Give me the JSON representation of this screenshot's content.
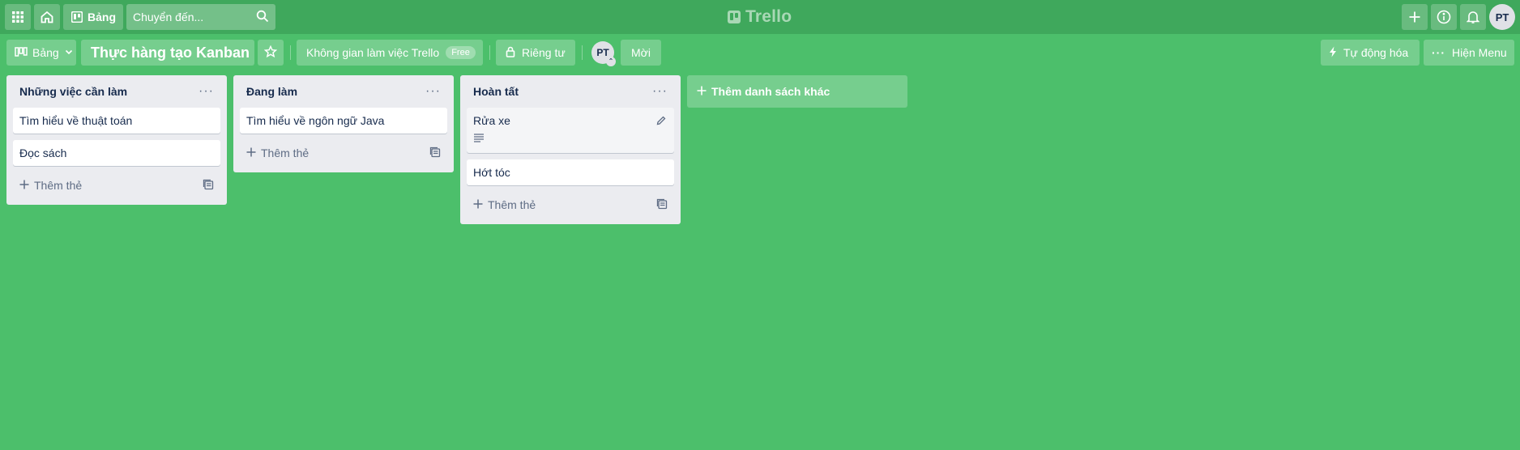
{
  "topbar": {
    "boards_label": "Bảng",
    "search_placeholder": "Chuyển đến...",
    "logo_text": "Trello",
    "user_initials": "PT"
  },
  "board": {
    "view_label": "Bảng",
    "title": "Thực hàng tạo Kanban",
    "workspace_label": "Không gian làm việc Trello",
    "workspace_badge": "Free",
    "visibility_label": "Riêng tư",
    "member_initials": "PT",
    "invite_label": "Mời",
    "automation_label": "Tự động hóa",
    "menu_label": "Hiện Menu"
  },
  "lists": [
    {
      "title": "Những việc cần làm",
      "cards": [
        "Tìm hiểu về thuật toán",
        "Đọc sách"
      ],
      "add_label": "Thêm thẻ"
    },
    {
      "title": "Đang làm",
      "cards": [
        "Tìm hiểu về ngôn ngữ Java"
      ],
      "add_label": "Thêm thẻ"
    },
    {
      "title": "Hoàn tất",
      "cards": [
        "Rửa xe",
        "Hớt tóc"
      ],
      "add_label": "Thêm thẻ"
    }
  ],
  "add_list_label": "Thêm danh sách khác",
  "colors": {
    "board_bg": "#4cbf6b",
    "header_bg": "#3fa85c",
    "list_bg": "#ebecf0"
  }
}
